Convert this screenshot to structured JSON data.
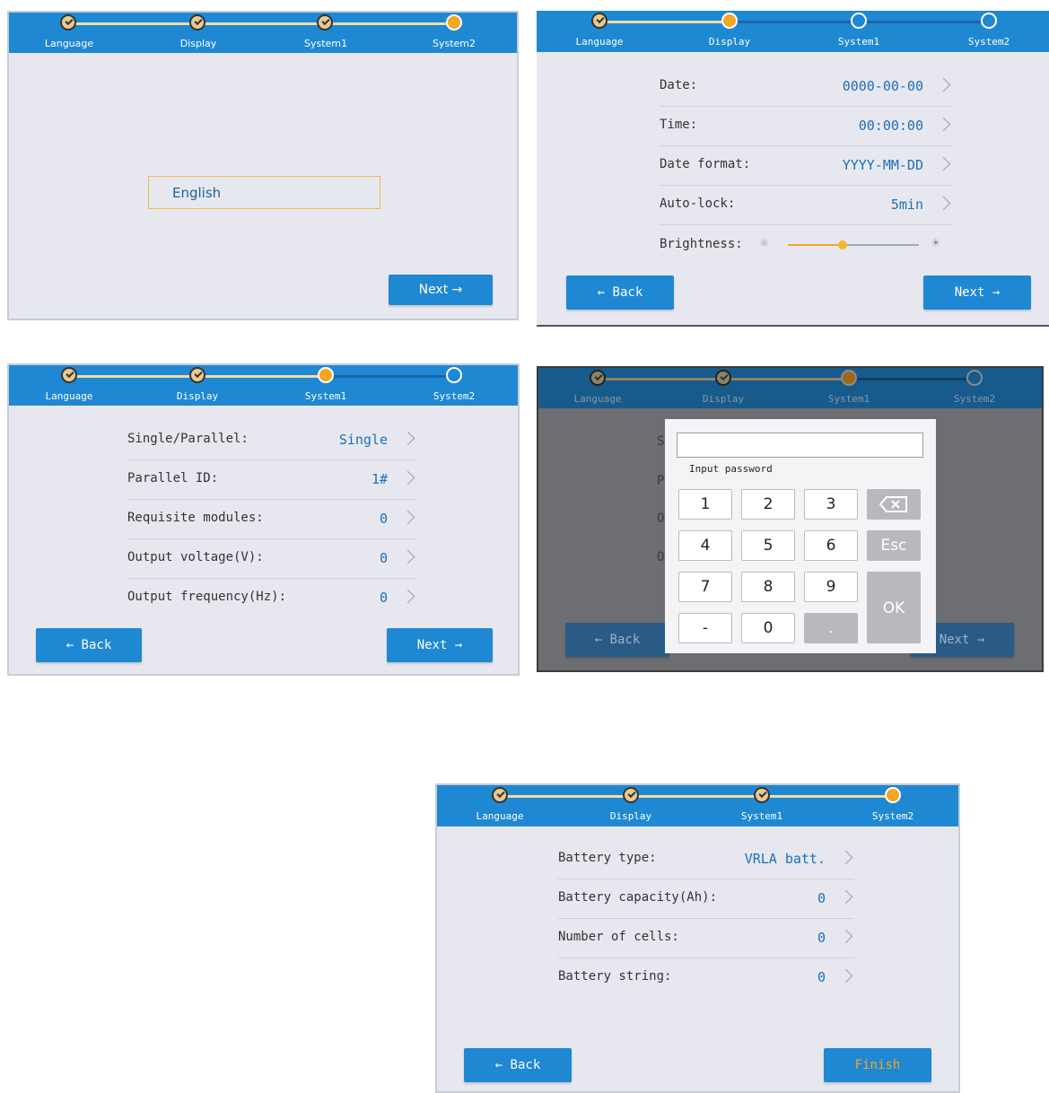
{
  "steps": [
    "Language",
    "Display",
    "System1",
    "System2"
  ],
  "language_screen": {
    "selected_language": "English",
    "next_label": "Next →"
  },
  "display_screen": {
    "rows": [
      {
        "label": "Date:",
        "value": "0000-00-00"
      },
      {
        "label": "Time:",
        "value": "00:00:00"
      },
      {
        "label": "Date format:",
        "value": "YYYY-MM-DD"
      },
      {
        "label": "Auto-lock:",
        "value": "5min"
      }
    ],
    "brightness_label": "Brightness:",
    "brightness_level": 0.42,
    "back_label": "← Back",
    "next_label": "Next →"
  },
  "system1_screen": {
    "rows": [
      {
        "label": "Single/Parallel:",
        "value": "Single"
      },
      {
        "label": "Parallel ID:",
        "value": "1#"
      },
      {
        "label": "Requisite modules:",
        "value": "0"
      },
      {
        "label": "Output voltage(V):",
        "value": "0"
      },
      {
        "label": "Output frequency(Hz):",
        "value": "0"
      }
    ],
    "back_label": "← Back",
    "next_label": "Next →"
  },
  "password_screen": {
    "hint": "Input password",
    "keys": [
      "1",
      "2",
      "3",
      "4",
      "5",
      "6",
      "7",
      "8",
      "9",
      "-",
      "0",
      "."
    ],
    "esc_label": "Esc",
    "ok_label": "OK",
    "back_label": "← Back",
    "next_label": "Next →",
    "bg_row_letters": [
      "S",
      "P",
      "O",
      "O"
    ]
  },
  "system2_screen": {
    "rows": [
      {
        "label": "Battery type:",
        "value": "VRLA batt."
      },
      {
        "label": "Battery capacity(Ah):",
        "value": "0"
      },
      {
        "label": "Number of cells:",
        "value": "0"
      },
      {
        "label": "Battery string:",
        "value": "0"
      }
    ],
    "back_label": "← Back",
    "finish_label": "Finish"
  },
  "colors": {
    "header_blue": "#1f88d3",
    "accent_orange": "#f5a623",
    "done_line": "#f2dca4",
    "value_blue": "#1e6fb8"
  }
}
